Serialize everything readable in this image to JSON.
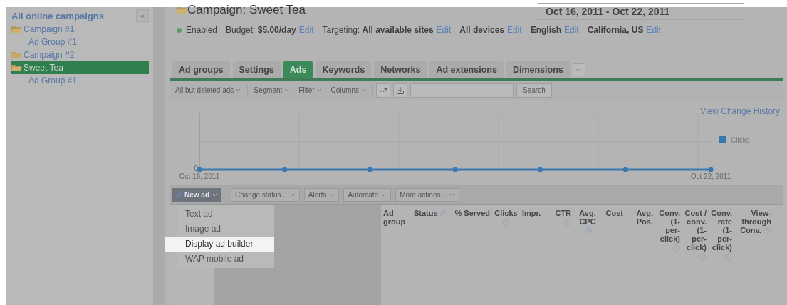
{
  "sidebar": {
    "collapse": "«",
    "title": "All online campaigns",
    "items": [
      {
        "label": "Campaign #1",
        "expanded": true,
        "selected": false,
        "children": [
          {
            "label": "Ad Group #1",
            "selected": false
          }
        ]
      },
      {
        "label": "Campaign #2",
        "expanded": false,
        "selected": false
      },
      {
        "label": "Sweet Tea",
        "expanded": true,
        "selected": true,
        "children": [
          {
            "label": "Ad Group #1",
            "selected": false
          }
        ]
      }
    ]
  },
  "header": {
    "title": "Campaign: Sweet Tea",
    "date_range": "Oct 16, 2011 - Oct 22, 2011",
    "status": {
      "label": "Enabled",
      "color": "#5f9a6c"
    },
    "settings": [
      {
        "text": "Budget: **$5.00/day**",
        "link": "Edit"
      },
      {
        "text": "Targeting: **All available sites**",
        "link": "Edit"
      },
      {
        "text": "**All devices**",
        "link": "Edit"
      },
      {
        "text": "**English**",
        "link": "Edit"
      },
      {
        "text": "**California, US**",
        "link": "Edit"
      }
    ]
  },
  "tabs": [
    {
      "label": "Ad groups",
      "selected": false
    },
    {
      "label": "Settings",
      "selected": false
    },
    {
      "label": "Ads",
      "selected": true
    },
    {
      "label": "Keywords",
      "selected": false
    },
    {
      "label": "Networks",
      "selected": false
    },
    {
      "label": "Ad extensions",
      "selected": false
    },
    {
      "label": "Dimensions",
      "selected": false
    }
  ],
  "toolbar": {
    "filters": [
      "All but deleted ads",
      "Segment",
      "Filter",
      "Columns"
    ],
    "search_button": "Search"
  },
  "chart": {
    "link": "View Change History",
    "baseline_label": "0",
    "start_label": "Oct 16, 2011",
    "end_label": "Oct 22, 2011",
    "legend": "Clicks"
  },
  "actions": {
    "new_ad": "New ad",
    "buttons": [
      "Change status...",
      "Alerts",
      "Automate",
      "More actions..."
    ]
  },
  "new_ad_menu": [
    {
      "label": "Text ad",
      "selected": false
    },
    {
      "label": "Image ad",
      "selected": false
    },
    {
      "label": "Display ad builder",
      "selected": true
    },
    {
      "label": "WAP mobile ad",
      "selected": false
    }
  ],
  "columns": [
    {
      "label": "Ad group",
      "help": false
    },
    {
      "label": "Status",
      "help": true
    },
    {
      "label": "% Served",
      "help": false
    },
    {
      "label": "Clicks",
      "help": true
    },
    {
      "label": "Impr.",
      "help": false
    },
    {
      "label": "CTR",
      "help": true
    },
    {
      "label": "Avg. CPC",
      "help": true
    },
    {
      "label": "Cost",
      "help": false
    },
    {
      "label": "Avg. Pos.",
      "help": false
    },
    {
      "label": "Conv. (1-per-click)",
      "help": true
    },
    {
      "label": "Cost / conv. (1-per-click)",
      "help": true
    },
    {
      "label": "Conv. rate (1-per-click)",
      "help": true
    },
    {
      "label": "View-through Conv.",
      "help": true
    }
  ]
}
